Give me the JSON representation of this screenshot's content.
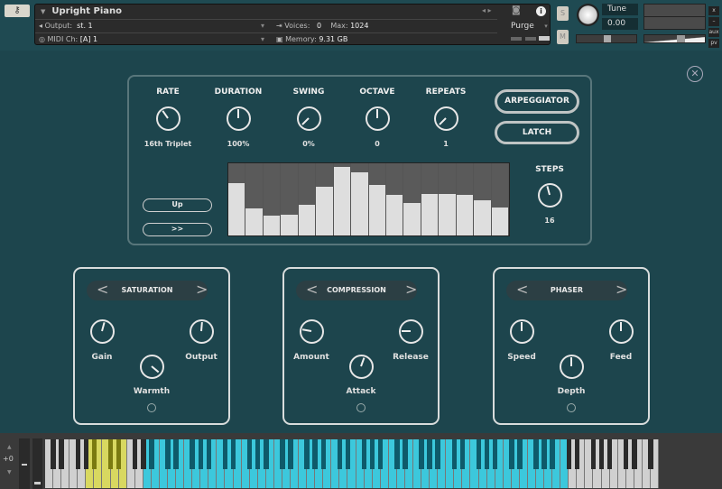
{
  "header": {
    "title": "Upright Piano",
    "output_label": "Output:",
    "output_value": "st. 1",
    "midi_label": "MIDI Ch:",
    "midi_value": "[A]  1",
    "voices_label": "Voices:",
    "voices_value": "0",
    "max_label": "Max:",
    "max_value": "1024",
    "memory_label": "Memory:",
    "memory_value": "9.31 GB",
    "purge_label": "Purge",
    "solo": "S",
    "mute": "M",
    "tune_label": "Tune",
    "tune_value": "0.00",
    "tiny": [
      "x",
      "–",
      "aux",
      "pv"
    ]
  },
  "arp": {
    "knobs": [
      {
        "label": "RATE",
        "value": "16th Triplet",
        "angle": -35
      },
      {
        "label": "DURATION",
        "value": "100%",
        "angle": 0
      },
      {
        "label": "SWING",
        "value": "0%",
        "angle": -135
      },
      {
        "label": "OCTAVE",
        "value": "0",
        "angle": 0
      },
      {
        "label": "REPEATS",
        "value": "1",
        "angle": -135
      }
    ],
    "arpeggiator_label": "ARPEGGIATOR",
    "latch_label": "LATCH",
    "direction_label": "Up",
    "order_label": ">>",
    "steps_label": "STEPS",
    "steps_value": "16",
    "steps_angle": -15,
    "step_values": [
      0.73,
      0.38,
      0.27,
      0.29,
      0.42,
      0.67,
      0.95,
      0.87,
      0.7,
      0.56,
      0.45,
      0.58,
      0.58,
      0.56,
      0.49,
      0.39
    ]
  },
  "effects": [
    {
      "title": "SATURATION",
      "knobs": [
        {
          "label": "Gain",
          "angle": 15
        },
        {
          "label": "Output",
          "angle": 5
        },
        {
          "label": "Warmth",
          "angle": 130
        }
      ]
    },
    {
      "title": "COMPRESSION",
      "knobs": [
        {
          "label": "Amount",
          "angle": -80
        },
        {
          "label": "Release",
          "angle": -90
        },
        {
          "label": "Attack",
          "angle": 20
        }
      ]
    },
    {
      "title": "PHASER",
      "knobs": [
        {
          "label": "Speed",
          "angle": 0
        },
        {
          "label": "Feed",
          "angle": 0
        },
        {
          "label": "Depth",
          "angle": 0
        }
      ]
    }
  ],
  "keyboard": {
    "octave_shift": "+0",
    "white_keys": 75,
    "yellow_range": [
      5,
      9
    ],
    "cyan_range": [
      12,
      63
    ],
    "colors": {
      "yellow": "#d8d860",
      "cyan": "#3cc8dc"
    }
  }
}
